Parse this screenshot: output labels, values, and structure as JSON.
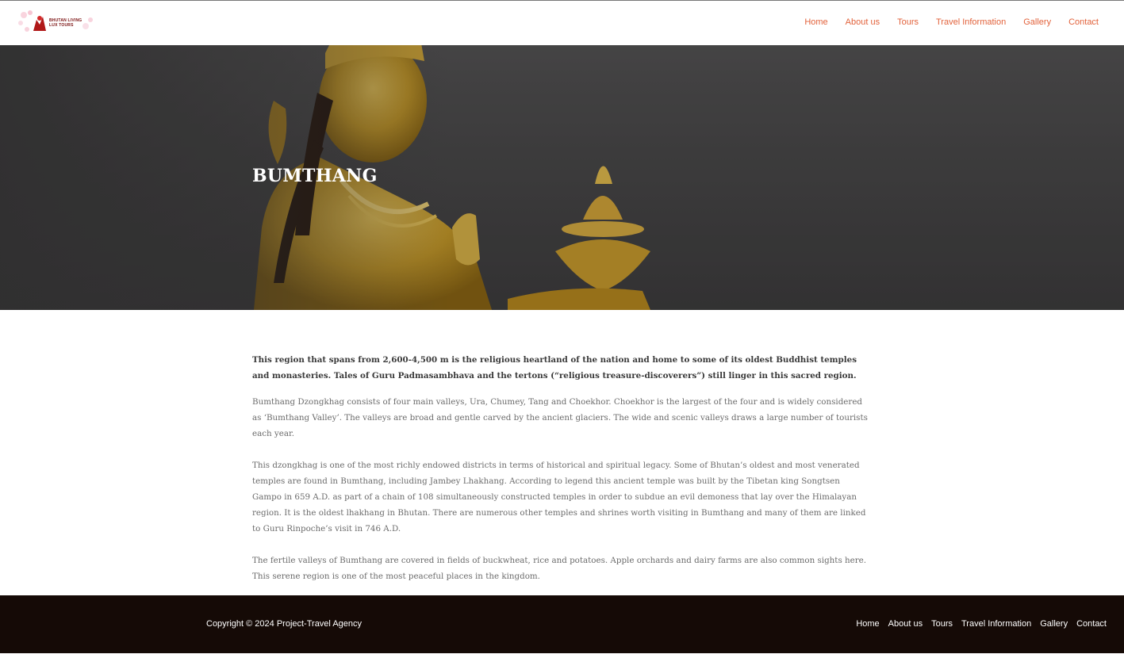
{
  "header": {
    "logo_text": "BHUTAN LIVING\nLUX TOURS",
    "nav": [
      "Home",
      "About us",
      "Tours",
      "Travel Information",
      "Gallery",
      "Contact"
    ]
  },
  "hero": {
    "title": "BUMTHANG"
  },
  "content": {
    "lead": "This region that spans from 2,600-4,500 m is the religious heartland of the nation and home to some of its oldest Buddhist temples and monasteries. Tales of Guru Padmasambhava and the tertons (“religious treasure-discoverers”) still linger in this sacred region.",
    "paragraphs": [
      "Bumthang Dzongkhag consists of four main valleys, Ura, Chumey, Tang and Choekhor. Choekhor is the largest of the four and is widely considered as ‘Bumthang Valley’. The valleys are broad and gentle carved by the ancient glaciers. The wide and scenic valleys draws a large number of tourists each year.",
      "This dzongkhag is one of the most richly endowed districts in terms of historical and spiritual legacy. Some of Bhutan’s oldest and most venerated temples are found in Bumthang, including Jambey Lhakhang. According to legend this ancient temple was built by the Tibetan king Songtsen Gampo in 659 A.D. as part of a chain of 108 simultaneously constructed temples in order to subdue an evil demoness that lay over the Himalayan region. It is the oldest lhakhang in Bhutan. There are numerous other temples and shrines worth visiting in Bumthang and many of them are linked to Guru Rinpoche’s visit in 746 A.D.",
      "The fertile valleys of Bumthang are covered in fields of buckwheat, rice and potatoes. Apple orchards and dairy farms are also common sights here. This serene region is one of the most peaceful places in the kingdom."
    ]
  },
  "footer": {
    "copyright": "Copyright © 2024 Project-Travel Agency",
    "nav": [
      "Home",
      "About us",
      "Tours",
      "Travel Information",
      "Gallery",
      "Contact"
    ]
  },
  "colors": {
    "nav_accent": "#e2623b",
    "footer_bg": "#150a06",
    "hero_gold": "#c9a227"
  }
}
